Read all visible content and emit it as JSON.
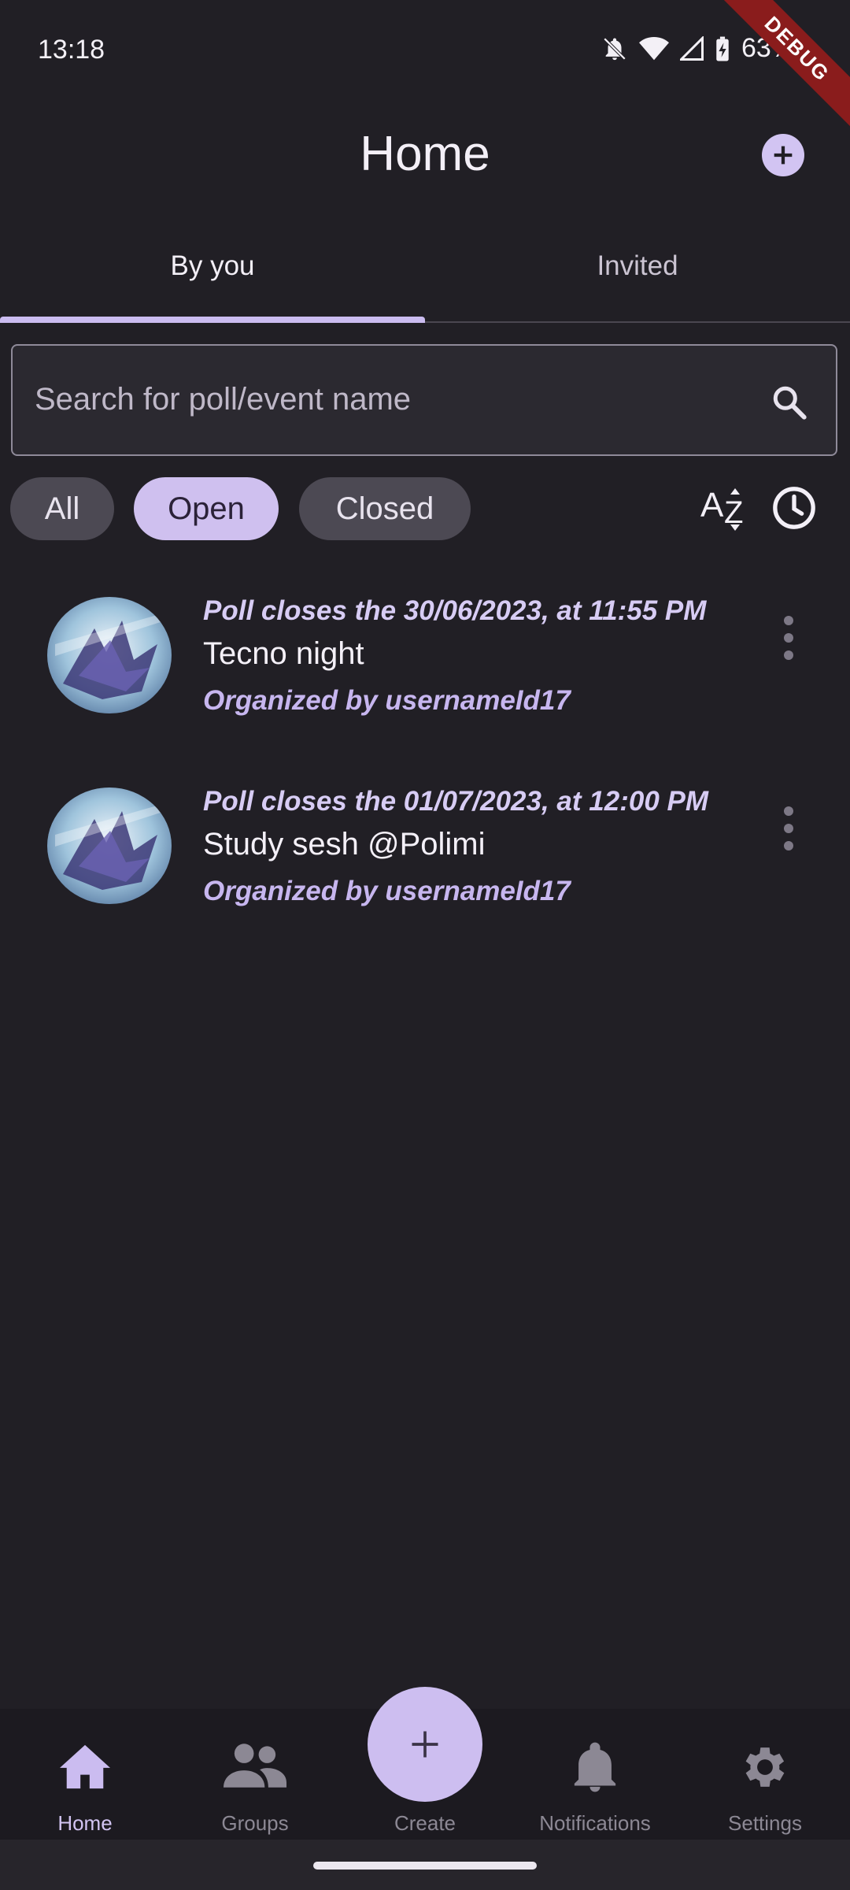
{
  "status_bar": {
    "time": "13:18",
    "battery": "63%",
    "debug_banner": "DEBUG"
  },
  "header": {
    "title": "Home"
  },
  "tabs": [
    {
      "label": "By you",
      "active": true
    },
    {
      "label": "Invited",
      "active": false
    }
  ],
  "search": {
    "placeholder": "Search for poll/event name"
  },
  "filters": {
    "chips": [
      {
        "label": "All"
      },
      {
        "label": "Open",
        "selected": true
      },
      {
        "label": "Closed"
      }
    ],
    "sort_icons": [
      "sort-az-icon",
      "clock-icon"
    ]
  },
  "polls": [
    {
      "closes": "Poll closes the 30/06/2023, at 11:55 PM",
      "title": "Tecno night",
      "organizer": "Organized by usernameId17"
    },
    {
      "closes": "Poll closes the 01/07/2023, at 12:00 PM",
      "title": "Study sesh @Polimi",
      "organizer": "Organized by usernameId17"
    }
  ],
  "bottom_nav": {
    "items": [
      {
        "label": "Home",
        "icon": "home-icon",
        "active": true
      },
      {
        "label": "Groups",
        "icon": "groups-icon"
      },
      {
        "label": "Create",
        "icon": "plus-icon"
      },
      {
        "label": "Notifications",
        "icon": "bell-icon"
      },
      {
        "label": "Settings",
        "icon": "gear-icon"
      }
    ]
  },
  "colors": {
    "background": "#211f25",
    "accent": "#cdbef0",
    "chip_selected": "#cfc0ef"
  }
}
